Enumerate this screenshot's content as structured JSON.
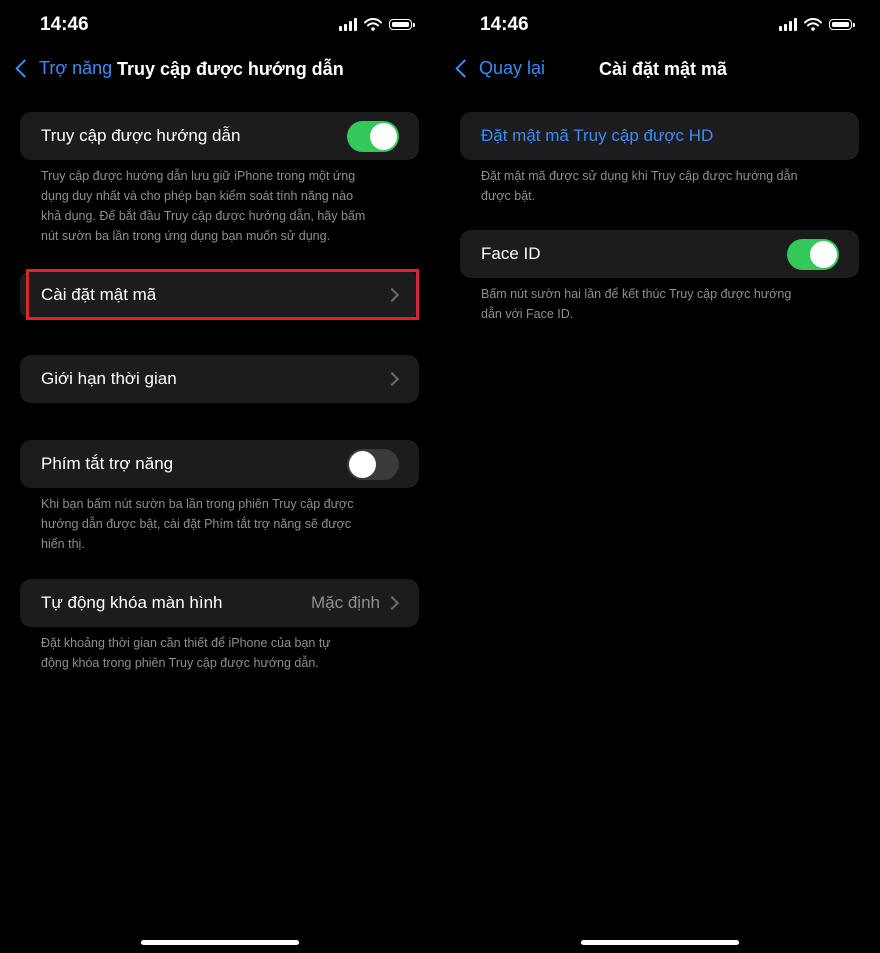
{
  "left": {
    "status": {
      "time": "14:46"
    },
    "nav": {
      "back_label": "Trợ năng",
      "title": "Truy cập được hướng dẫn"
    },
    "guided_access": {
      "label": "Truy cập được hướng dẫn",
      "toggle": "on",
      "footer_lines": [
        "Truy cập được hướng dẫn lưu giữ iPhone trong một ứng",
        "dụng duy nhất và cho phép bạn kiểm soát tính năng nào",
        "khả dụng. Để bắt đầu Truy cập được hướng dẫn, hãy bấm",
        "nút sườn ba lần trong ứng dụng bạn muốn sử dụng."
      ]
    },
    "passcode_settings": {
      "label": "Cài đặt mật mã"
    },
    "time_limits": {
      "label": "Giới hạn thời gian"
    },
    "accessibility_shortcut": {
      "label": "Phím tắt trợ năng",
      "toggle": "off",
      "footer_lines": [
        "Khi bạn bấm nút sườn ba lần trong phiên Truy cập được",
        "hướng dẫn được bật, cài đặt Phím tắt trợ năng sẽ được",
        "hiển thị."
      ]
    },
    "auto_lock": {
      "label": "Tự động khóa màn hình",
      "value": "Mặc định",
      "footer_lines": [
        "Đặt khoảng thời gian cần thiết để iPhone của bạn tự",
        "động khóa trong phiên Truy cập được hướng dẫn."
      ]
    },
    "highlight_color": "#d6252e"
  },
  "right": {
    "status": {
      "time": "14:46"
    },
    "nav": {
      "back_label": "Quay lại",
      "title": "Cài đặt mật mã"
    },
    "set_passcode": {
      "label": "Đặt mật mã Truy cập được HD",
      "footer_lines": [
        "Đặt mật mã được sử dụng khi Truy cập được hướng dẫn",
        "được bật."
      ]
    },
    "face_id": {
      "label": "Face ID",
      "toggle": "on",
      "footer_lines": [
        "Bấm nút sườn hai lần để kết thúc Truy cập được hướng",
        "dẫn với Face ID."
      ]
    }
  },
  "colors": {
    "accent": "#3a8cf5",
    "toggle_on": "#34c759",
    "cell_background": "#1c1c1e",
    "background": "#000000"
  },
  "icons": {
    "status": [
      "cellular-signal-icon",
      "wifi-icon",
      "battery-icon"
    ],
    "nav": "chevron-left-icon",
    "row": "chevron-right-icon"
  }
}
